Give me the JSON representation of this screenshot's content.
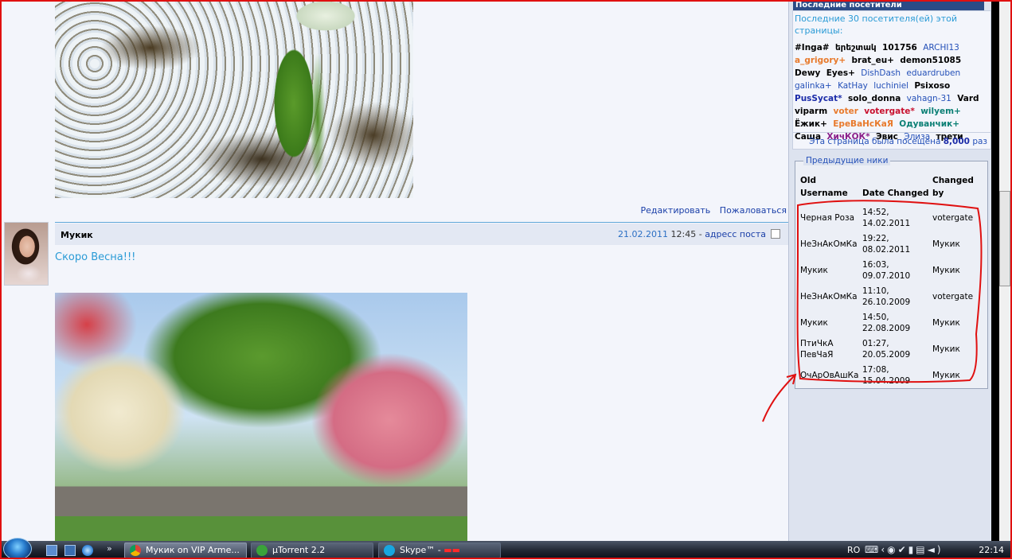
{
  "post_actions": {
    "edit": "Редактировать",
    "report": "Пожаловаться"
  },
  "post": {
    "author": "Мукик",
    "date": "21.02.2011",
    "time": "12:45",
    "separator": "-",
    "link": "адресс поста",
    "text": "Скоро Весна!!!"
  },
  "visitors": {
    "title": "Последние посетители",
    "subtitle": "Последние 30 посетителя(ей) этой страницы:",
    "list": [
      {
        "name": "#Inga#",
        "style": "v-bold"
      },
      {
        "name": "երեշտակ",
        "style": "v-bold"
      },
      {
        "name": "101756",
        "style": "v-bold"
      },
      {
        "name": "ARCHI13",
        "style": "v-blue"
      },
      {
        "name": "a_grigory+",
        "style": "v-orange"
      },
      {
        "name": "brat_eu+",
        "style": "v-bold"
      },
      {
        "name": "demon51085",
        "style": "v-bold"
      },
      {
        "name": "Dewy",
        "style": "v-bold"
      },
      {
        "name": "Eyes+",
        "style": "v-bold"
      },
      {
        "name": "DishDash",
        "style": "v-blue"
      },
      {
        "name": "eduardruben",
        "style": "v-blue"
      },
      {
        "name": "galinka+",
        "style": "v-blue"
      },
      {
        "name": "KatHay",
        "style": "v-blue"
      },
      {
        "name": "luchiniel",
        "style": "v-blue"
      },
      {
        "name": "Psixoso",
        "style": "v-bold"
      },
      {
        "name": "PusSycat*",
        "style": "v-navy"
      },
      {
        "name": "solo_donna",
        "style": "v-bold"
      },
      {
        "name": "vahagn-31",
        "style": "v-blue"
      },
      {
        "name": "Vard",
        "style": "v-bold"
      },
      {
        "name": "viparm",
        "style": "v-bold"
      },
      {
        "name": "voter",
        "style": "v-orange"
      },
      {
        "name": "votergate*",
        "style": "v-red"
      },
      {
        "name": "wilyem+",
        "style": "v-teal"
      },
      {
        "name": "Ёжик+",
        "style": "v-bold"
      },
      {
        "name": "ЕреВаНсКаЯ",
        "style": "v-orange"
      },
      {
        "name": "Одуванчик+",
        "style": "v-teal"
      },
      {
        "name": "Саша",
        "style": "v-bold"
      },
      {
        "name": "ХичКОК*",
        "style": "v-purple"
      },
      {
        "name": "Эвис",
        "style": "v-bold"
      },
      {
        "name": "Элиза",
        "style": "v-blue"
      },
      {
        "name": "трети",
        "style": "v-bold"
      }
    ],
    "visits_prefix": "Эта страница была посещена",
    "visits_count": "8,000",
    "visits_suffix": "раз"
  },
  "nicks": {
    "legend": "Предыдущие ники",
    "headers": [
      "Old Username",
      "Date Changed",
      "Changed by"
    ],
    "rows": [
      [
        "Черная Роза",
        "14:52, 14.02.2011",
        "votergate"
      ],
      [
        "НеЗнАкОмКа",
        "19:22, 08.02.2011",
        "Мукик"
      ],
      [
        "Мукик",
        "16:03, 09.07.2010",
        "Мукик"
      ],
      [
        "НеЗнАкОмКа",
        "11:10, 26.10.2009",
        "votergate"
      ],
      [
        "Мукик",
        "14:50, 22.08.2009",
        "Мукик"
      ],
      [
        "ПтиЧкА ПевЧаЯ",
        "01:27, 20.05.2009",
        "Мукик"
      ],
      [
        "ОчАрОвАшКа",
        "17:08, 15.04.2009",
        "Мукик"
      ]
    ]
  },
  "taskbar": {
    "more": "»",
    "tasks": [
      {
        "label": "Мукик on VIP Arme..."
      },
      {
        "label": "µTorrent 2.2"
      },
      {
        "label": "Skype™ -"
      }
    ],
    "lang": "RO",
    "clock": "22:14"
  },
  "colors": {
    "annotation": "#e01010",
    "link": "#1a3fa8",
    "accent": "#2a9bd6",
    "panel_header": "#2b4b86"
  }
}
